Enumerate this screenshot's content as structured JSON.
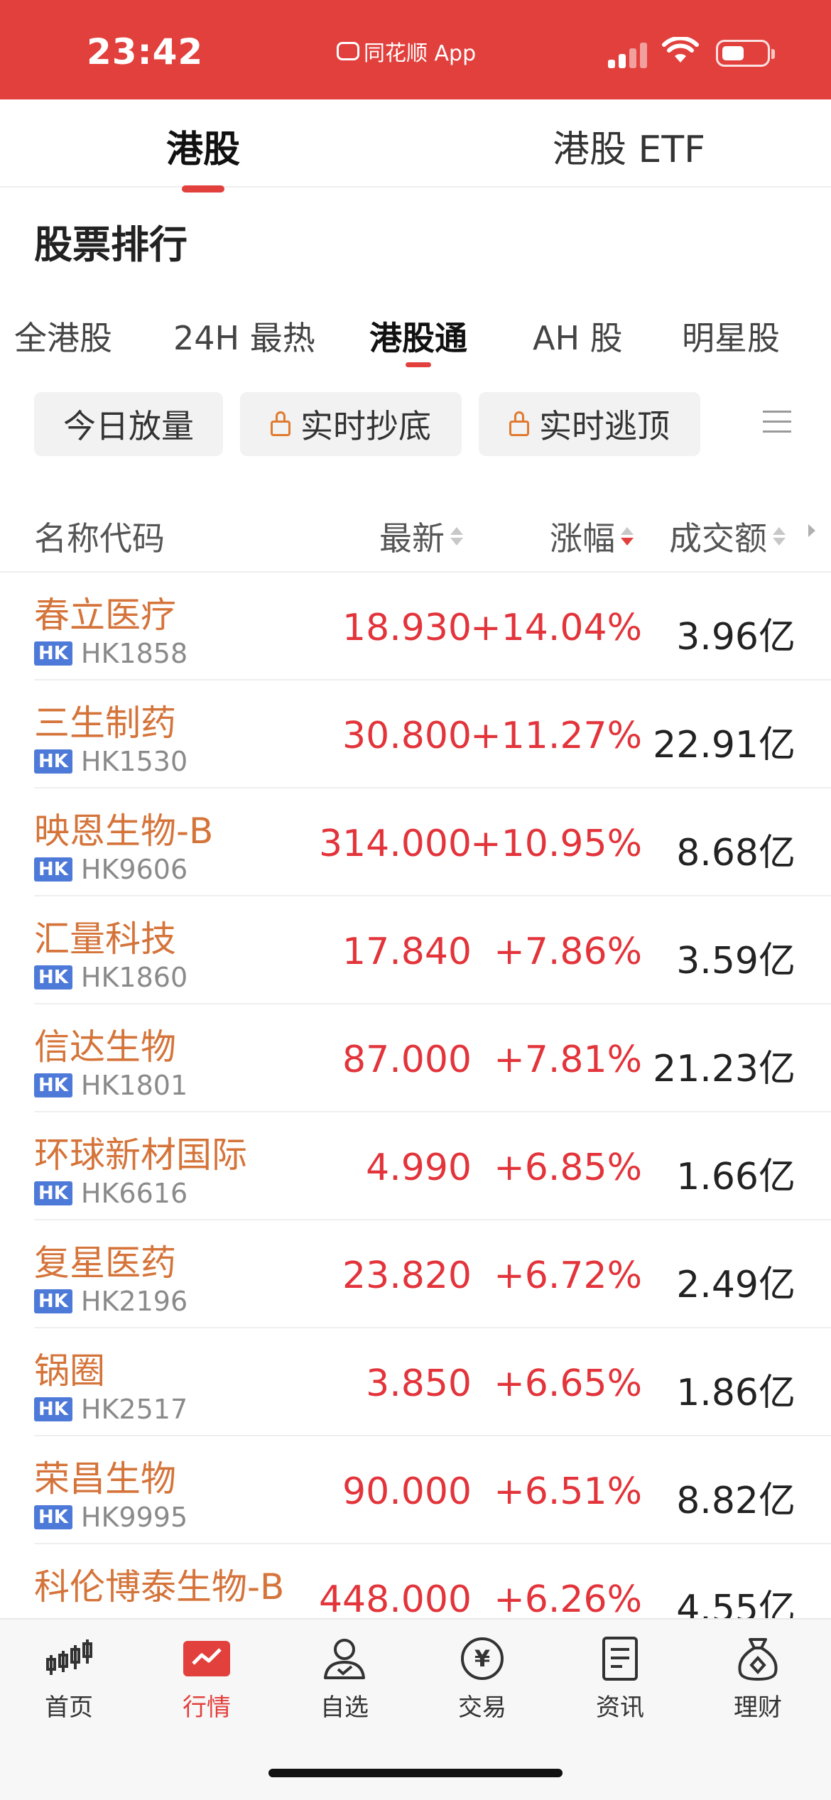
{
  "status_bar": {
    "time": "23:42",
    "app_label": "同花顺 App"
  },
  "top_tabs": [
    {
      "label": "港股",
      "active": true
    },
    {
      "label": "港股 ETF",
      "active": false
    }
  ],
  "section_title": "股票排行",
  "category_tabs": [
    {
      "label": "全港股",
      "active": false
    },
    {
      "label": "24H 最热",
      "active": false
    },
    {
      "label": "港股通",
      "active": true
    },
    {
      "label": "AH 股",
      "active": false
    },
    {
      "label": "明星股",
      "active": false
    }
  ],
  "filters": [
    {
      "label": "今日放量",
      "locked": false
    },
    {
      "label": "实时抄底",
      "locked": true
    },
    {
      "label": "实时逃顶",
      "locked": true
    }
  ],
  "table": {
    "headers": {
      "name": "名称代码",
      "latest": "最新",
      "change": "涨幅",
      "volume": "成交额"
    },
    "sort": {
      "column": "涨幅",
      "direction": "descending"
    },
    "badge": "HK",
    "rows": [
      {
        "name": "春立医疗",
        "code": "HK1858",
        "latest": "18.930",
        "change": "+14.04%",
        "volume": "3.96亿"
      },
      {
        "name": "三生制药",
        "code": "HK1530",
        "latest": "30.800",
        "change": "+11.27%",
        "volume": "22.91亿"
      },
      {
        "name": "映恩生物-B",
        "code": "HK9606",
        "latest": "314.000",
        "change": "+10.95%",
        "volume": "8.68亿"
      },
      {
        "name": "汇量科技",
        "code": "HK1860",
        "latest": "17.840",
        "change": "+7.86%",
        "volume": "3.59亿"
      },
      {
        "name": "信达生物",
        "code": "HK1801",
        "latest": "87.000",
        "change": "+7.81%",
        "volume": "21.23亿"
      },
      {
        "name": "环球新材国际",
        "code": "HK6616",
        "latest": "4.990",
        "change": "+6.85%",
        "volume": "1.66亿"
      },
      {
        "name": "复星医药",
        "code": "HK2196",
        "latest": "23.820",
        "change": "+6.72%",
        "volume": "2.49亿"
      },
      {
        "name": "锅圈",
        "code": "HK2517",
        "latest": "3.850",
        "change": "+6.65%",
        "volume": "1.86亿"
      },
      {
        "name": "荣昌生物",
        "code": "HK9995",
        "latest": "90.000",
        "change": "+6.51%",
        "volume": "8.82亿"
      },
      {
        "name": "科伦博泰生物-B",
        "code": "",
        "latest": "448.000",
        "change": "+6.26%",
        "volume": "4.55亿"
      }
    ]
  },
  "bottom_nav": [
    {
      "label": "首页",
      "icon": "candlestick-icon",
      "active": false
    },
    {
      "label": "行情",
      "icon": "market-chart-icon",
      "active": true
    },
    {
      "label": "自选",
      "icon": "person-icon",
      "active": false
    },
    {
      "label": "交易",
      "icon": "yen-coin-icon",
      "active": false
    },
    {
      "label": "资讯",
      "icon": "document-icon",
      "active": false
    },
    {
      "label": "理财",
      "icon": "money-bag-icon",
      "active": false
    }
  ],
  "colors": {
    "brand_red": "#e2403d",
    "rise_red": "#e2343a",
    "name_orange": "#d5743a",
    "hk_badge_blue": "#4d79d8"
  }
}
